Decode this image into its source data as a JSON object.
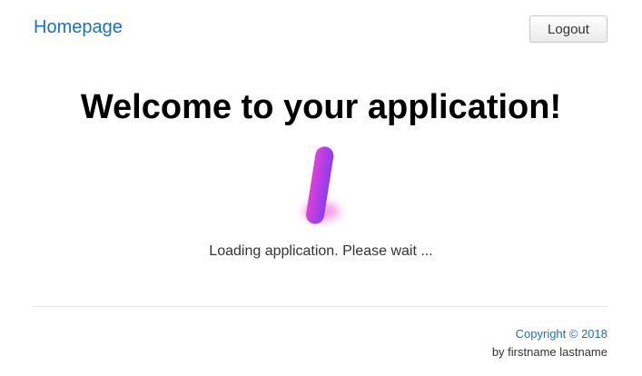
{
  "header": {
    "homepage_label": "Homepage",
    "logout_label": "Logout"
  },
  "main": {
    "title": "Welcome to your application!",
    "loading_text": "Loading application. Please wait ...",
    "loader_icon": "loading-spinner-icon",
    "loader_colors": [
      "#e040d8",
      "#8a3df0"
    ]
  },
  "footer": {
    "copyright": "Copyright © 2018",
    "byline": "by firstname lastname"
  },
  "colors": {
    "link": "#1a6fd0",
    "text": "#333333",
    "title": "#000000"
  }
}
